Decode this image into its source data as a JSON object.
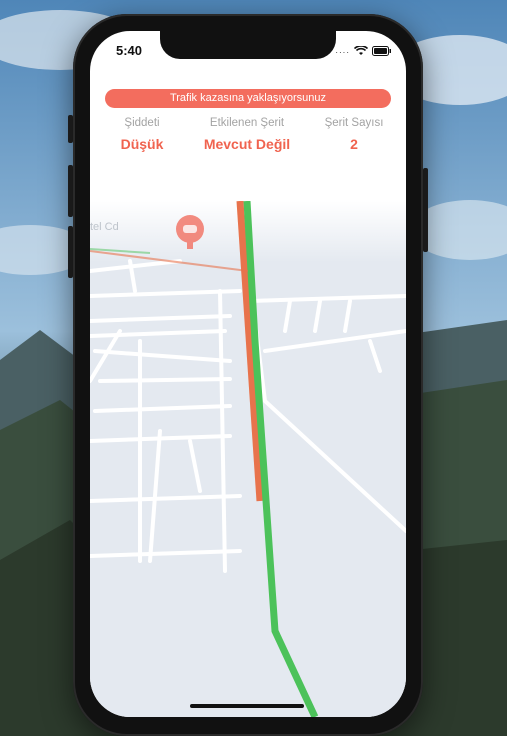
{
  "status_bar": {
    "time": "5:40",
    "signal_icon": "signal-dots-icon",
    "wifi_icon": "wifi-icon",
    "battery_icon": "battery-icon"
  },
  "alert": {
    "text": "Trafik kazasına yaklaşıyorsunuz",
    "color": "#f36d5e"
  },
  "incident": {
    "severity_label": "Şiddeti",
    "severity_value": "Düşük",
    "lane_label": "Etkilenen Şerit",
    "lane_value": "Mevcut Değil",
    "count_label": "Şerit Sayısı",
    "count_value": "2"
  },
  "map": {
    "street_label": "tel Cd",
    "marker_icon": "accident-marker-icon",
    "route_colors": {
      "traffic": "#e8734c",
      "clear": "#4cc25a"
    }
  },
  "colors": {
    "accent": "#f0634f",
    "map_bg": "#e4e9f0"
  }
}
